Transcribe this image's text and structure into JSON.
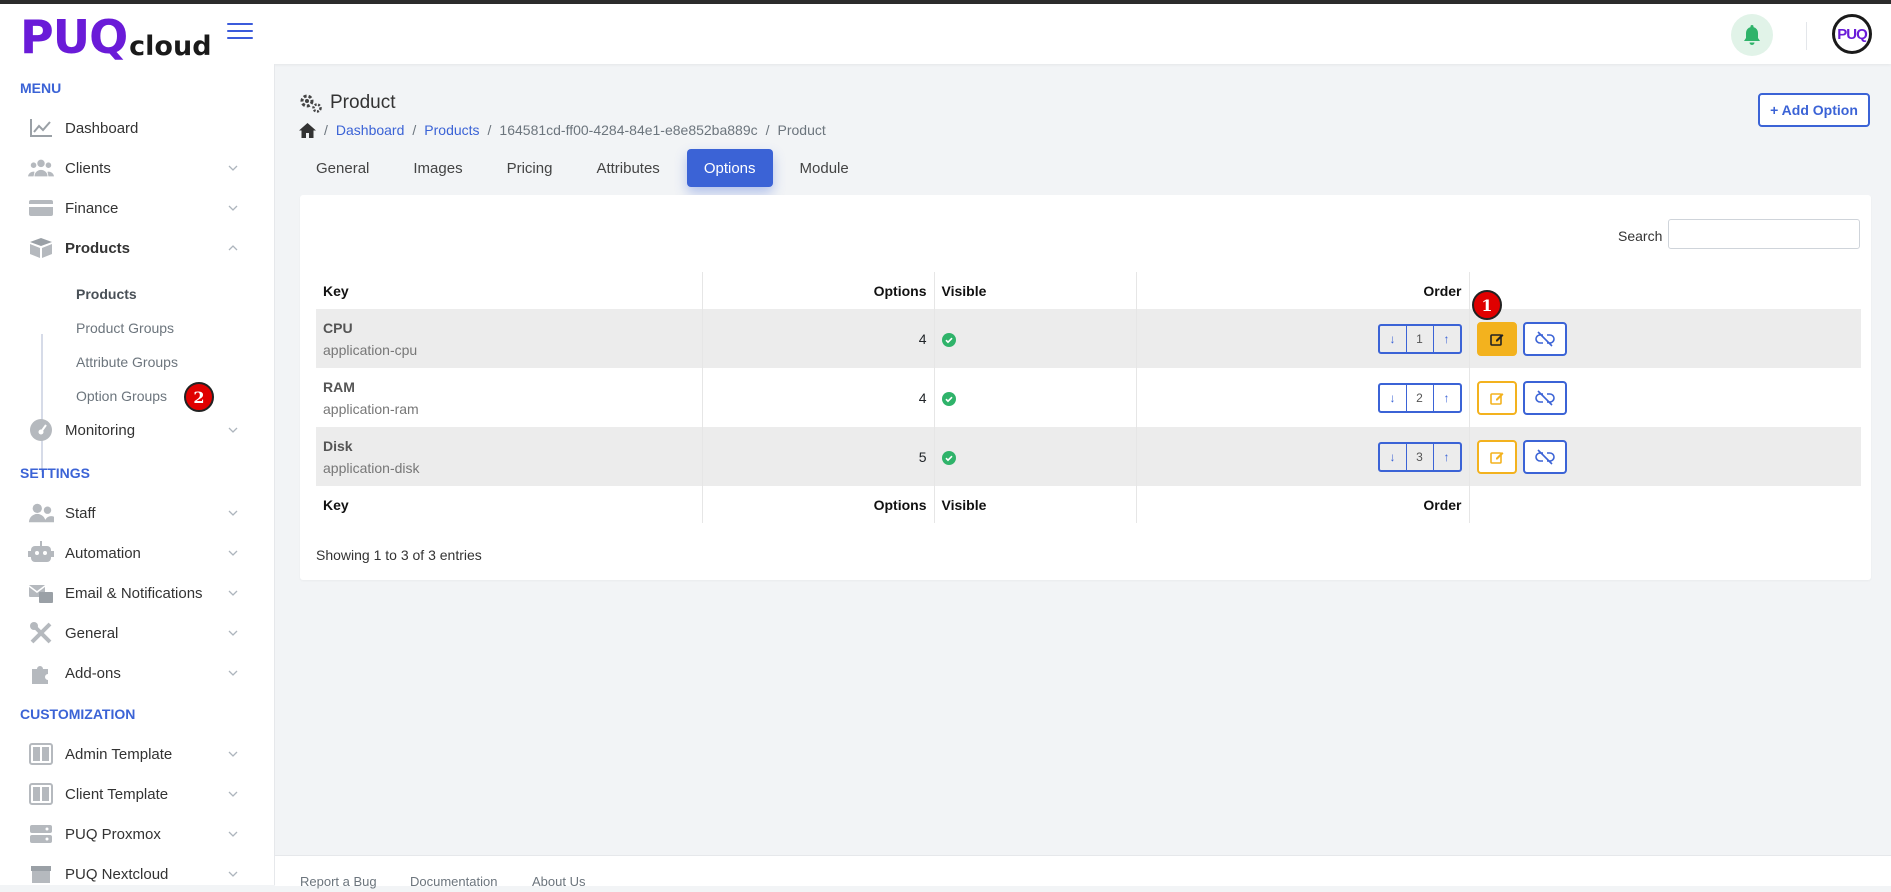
{
  "brand": {
    "main": "PUQ",
    "sub": "cloud"
  },
  "header": {
    "avatar_text": "PUQ"
  },
  "sidebar": {
    "sections": {
      "menu": "MENU",
      "settings": "SETTINGS",
      "customization": "CUSTOMIZATION"
    },
    "items": [
      {
        "label": "Dashboard",
        "icon": "chart-line-icon"
      },
      {
        "label": "Clients",
        "icon": "users-icon"
      },
      {
        "label": "Finance",
        "icon": "credit-card-icon"
      },
      {
        "label": "Products",
        "icon": "box-icon"
      },
      {
        "label": "Monitoring",
        "icon": "gauge-icon"
      },
      {
        "label": "Staff",
        "icon": "user-group-icon"
      },
      {
        "label": "Automation",
        "icon": "robot-icon"
      },
      {
        "label": "Email & Notifications",
        "icon": "mail-bulk-icon"
      },
      {
        "label": "General",
        "icon": "tools-icon"
      },
      {
        "label": "Add-ons",
        "icon": "puzzle-icon"
      },
      {
        "label": "Admin Template",
        "icon": "template-icon"
      },
      {
        "label": "Client Template",
        "icon": "template-icon"
      },
      {
        "label": "PUQ Proxmox",
        "icon": "server-icon"
      },
      {
        "label": "PUQ Nextcloud",
        "icon": "box-icon"
      }
    ],
    "products_sub": [
      "Products",
      "Product Groups",
      "Attribute Groups",
      "Option Groups"
    ]
  },
  "badges": {
    "one": "1",
    "two": "2"
  },
  "page": {
    "title": "Product",
    "breadcrumb": [
      "Dashboard",
      "Products",
      "164581cd-ff00-4284-84e1-e8e852ba889c",
      "Product"
    ],
    "add_button": "+ Add Option",
    "tabs": [
      "General",
      "Images",
      "Pricing",
      "Attributes",
      "Options",
      "Module"
    ],
    "active_tab": "Options"
  },
  "table": {
    "search_label": "Search",
    "search_value": "",
    "columns": {
      "key": "Key",
      "options": "Options",
      "visible": "Visible",
      "order": "Order"
    },
    "rows": [
      {
        "title": "CPU",
        "key": "application-cpu",
        "options": "4",
        "visible": true,
        "order": "1"
      },
      {
        "title": "RAM",
        "key": "application-ram",
        "options": "4",
        "visible": true,
        "order": "2"
      },
      {
        "title": "Disk",
        "key": "application-disk",
        "options": "5",
        "visible": true,
        "order": "3"
      }
    ],
    "info": "Showing 1 to 3 of 3 entries"
  },
  "footer": {
    "links": [
      "Report a Bug",
      "Documentation",
      "About Us"
    ]
  },
  "colors": {
    "accent": "#3b63d6",
    "brand": "#6a1bd8",
    "warning": "#f3b21e",
    "success": "#2fb36a",
    "badge": "#e00000"
  }
}
